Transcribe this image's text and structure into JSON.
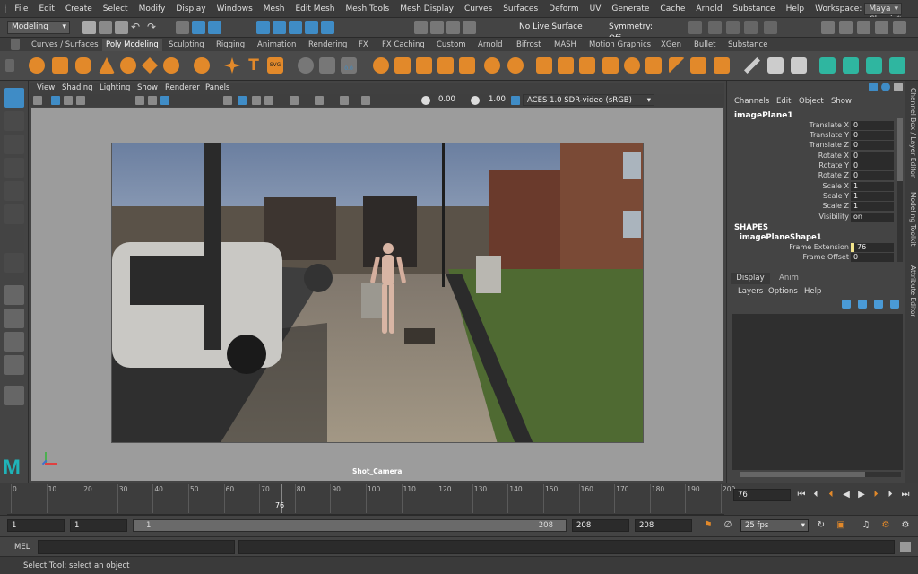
{
  "menubar": {
    "items": [
      "File",
      "Edit",
      "Create",
      "Select",
      "Modify",
      "Display",
      "Windows",
      "Mesh",
      "Edit Mesh",
      "Mesh Tools",
      "Mesh Display",
      "Curves",
      "Surfaces",
      "Deform",
      "UV",
      "Generate",
      "Cache",
      "Arnold",
      "Substance",
      "Help"
    ],
    "workspace_label": "Workspace:",
    "workspace_value": "Maya Classic*"
  },
  "status": {
    "mode": "Modeling",
    "live_surface": "No Live Surface",
    "symmetry": "Symmetry: Off"
  },
  "shelf_tabs": [
    "Curves / Surfaces",
    "Poly Modeling",
    "Sculpting",
    "Rigging",
    "Animation",
    "Rendering",
    "FX",
    "FX Caching",
    "Custom",
    "Arnold",
    "Bifrost",
    "MASH",
    "Motion Graphics",
    "XGen",
    "Bullet",
    "Substance"
  ],
  "active_shelf_tab": "Poly Modeling",
  "viewport": {
    "menus": [
      "View",
      "Shading",
      "Lighting",
      "Show",
      "Renderer",
      "Panels"
    ],
    "exposure": "0.00",
    "gamma": "1.00",
    "color_space": "ACES 1.0 SDR-video (sRGB)",
    "camera_label": "Shot_Camera"
  },
  "channel_box": {
    "menus": [
      "Channels",
      "Edit",
      "Object",
      "Show"
    ],
    "object_name": "imagePlane1",
    "attributes": [
      {
        "label": "Translate X",
        "value": "0"
      },
      {
        "label": "Translate Y",
        "value": "0"
      },
      {
        "label": "Translate Z",
        "value": "0"
      },
      {
        "label": "Rotate X",
        "value": "0"
      },
      {
        "label": "Rotate Y",
        "value": "0"
      },
      {
        "label": "Rotate Z",
        "value": "0"
      },
      {
        "label": "Scale X",
        "value": "1"
      },
      {
        "label": "Scale Y",
        "value": "1"
      },
      {
        "label": "Scale Z",
        "value": "1"
      },
      {
        "label": "Visibility",
        "value": "on"
      }
    ],
    "shapes_header": "SHAPES",
    "shape_name": "imagePlaneShape1",
    "shape_attributes": [
      {
        "label": "Frame Extension",
        "value": "76"
      },
      {
        "label": "Frame Offset",
        "value": "0"
      }
    ]
  },
  "layer_editor": {
    "tabs": [
      "Display",
      "Anim"
    ],
    "menus": [
      "Layers",
      "Options",
      "Help"
    ]
  },
  "side_tabs": [
    "Channel Box / Layer Editor",
    "Modeling Toolkit",
    "Attribute Editor"
  ],
  "timeline": {
    "ticks": [
      "0",
      "10",
      "20",
      "30",
      "40",
      "50",
      "60",
      "70",
      "80",
      "90",
      "100",
      "110",
      "120",
      "130",
      "140",
      "150",
      "160",
      "170",
      "180",
      "190",
      "200"
    ],
    "current_frame_label": "76",
    "current_frame_field": "76",
    "current_fraction": 0.38
  },
  "range": {
    "start_a": "1",
    "start_b": "1",
    "slider_start": "1",
    "slider_end": "208",
    "end_a": "208",
    "end_b": "208",
    "fps": "25 fps"
  },
  "mel": {
    "label": "MEL"
  },
  "help_line": "Select Tool: select an object",
  "colors": {
    "accent": "#3f8cc6",
    "shelf_orange": "#e2892a",
    "maya_logo": "#1fb3b8",
    "attr_highlight": "#f2e48a"
  }
}
